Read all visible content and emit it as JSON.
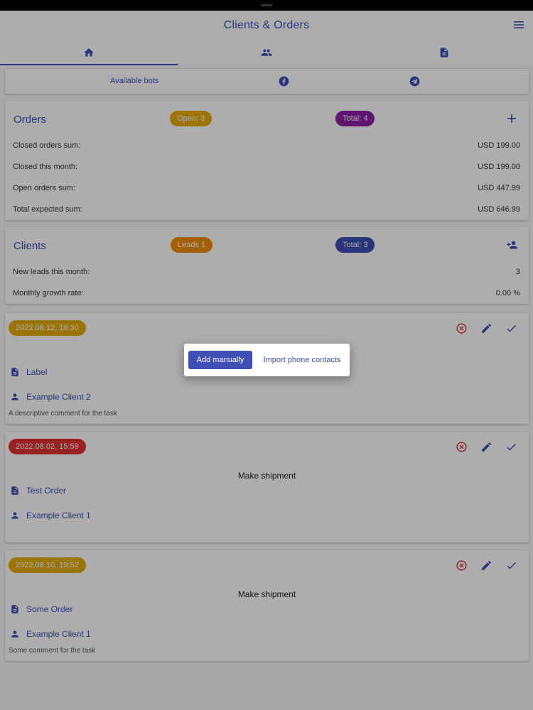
{
  "app": {
    "title": "Clients & Orders"
  },
  "icons": {
    "menu": "menu-icon",
    "home": "home-icon",
    "clients": "group-icon",
    "documents": "document-icon"
  },
  "bots": {
    "label": "Available bots"
  },
  "orders": {
    "title": "Orders",
    "open_badge": "Open: 3",
    "total_badge": "Total: 4",
    "rows": [
      {
        "label": "Closed orders sum:",
        "value": "USD 199.00"
      },
      {
        "label": "Closed this month:",
        "value": "USD 199.00"
      },
      {
        "label": "Open orders sum:",
        "value": "USD 447.99"
      },
      {
        "label": "Total expected sum:",
        "value": "USD 646.99"
      }
    ]
  },
  "clients": {
    "title": "Clients",
    "leads_badge": "Leads 1",
    "total_badge": "Total: 3",
    "rows": [
      {
        "label": "New leads this month:",
        "value": "3"
      },
      {
        "label": "Monthly growth rate:",
        "value": "0.00 %"
      }
    ]
  },
  "tasks": [
    {
      "date": "2022.08.12, 18:30",
      "title": "",
      "order": "Label",
      "client": "Example Client 2",
      "comment": "A descriptive comment for the task",
      "color": "#e6ac00"
    },
    {
      "date": "2022.08.02, 15:59",
      "title": "Make shipment",
      "order": "Test Order",
      "client": "Example Client 1",
      "comment": "",
      "color": "#e03131"
    },
    {
      "date": "2022.08.10, 19:52",
      "title": "Make shipment",
      "order": "Some Order",
      "client": "Example Client 1",
      "comment": "Some comment for the task",
      "color": "#e6ac00"
    }
  ],
  "popup": {
    "primary": "Add manually",
    "secondary": "Import phone contacts"
  },
  "colors": {
    "accent": "#3f4fb3",
    "open": "#e6ac00",
    "total_orders": "#8e1fa6",
    "leads": "#f08c00",
    "clients_total": "#3f4fb3",
    "danger": "#e03131"
  }
}
